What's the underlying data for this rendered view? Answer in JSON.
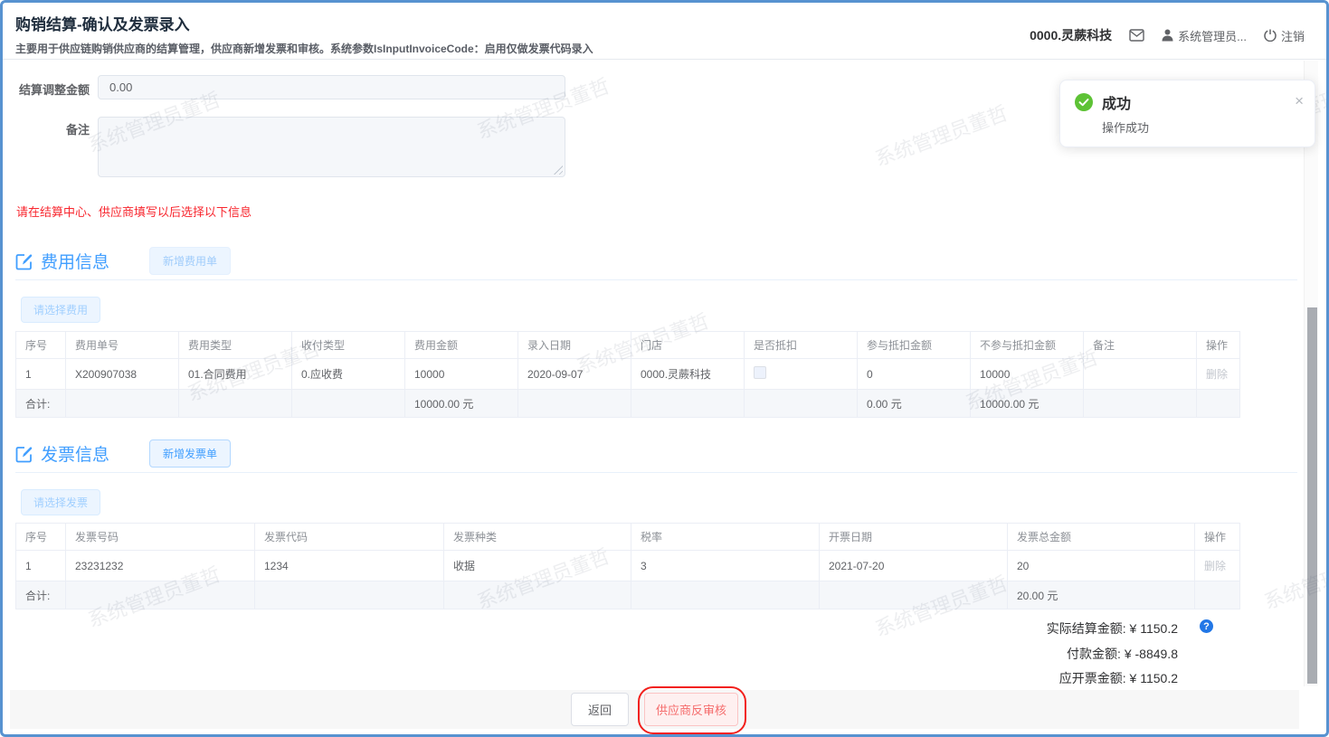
{
  "page": {
    "title": "购销结算-确认及发票录入",
    "subtitle": "主要用于供应链购销供应商的结算管理，供应商新增发票和审核。系统参数IsInputInvoiceCode：启用仅做发票代码录入"
  },
  "topbar": {
    "company": "0000.灵蕨科技",
    "user": "系统管理员...",
    "logout": "注销"
  },
  "toast": {
    "title": "成功",
    "message": "操作成功",
    "close": "×"
  },
  "form": {
    "adjust_label": "结算调整金额",
    "adjust_value": "0.00",
    "remark_label": "备注",
    "remark_value": ""
  },
  "warning": "请在结算中心、供应商填写以后选择以下信息",
  "fee_section": {
    "title": "费用信息",
    "add_button": "新增费用单",
    "select_button": "请选择费用",
    "table": {
      "headers": [
        "序号",
        "费用单号",
        "费用类型",
        "收付类型",
        "费用金额",
        "录入日期",
        "门店",
        "是否抵扣",
        "参与抵扣金额",
        "不参与抵扣金额",
        "备注",
        "操作"
      ],
      "rows": [
        [
          "1",
          "X200907038",
          "01.合同费用",
          "0.应收费",
          "10000",
          "2020-09-07",
          "0000.灵蕨科技",
          "",
          "0",
          "10000",
          "",
          "删除"
        ]
      ],
      "totals": [
        "合计:",
        "",
        "",
        "",
        "10000.00 元",
        "",
        "",
        "",
        "0.00 元",
        "10000.00 元",
        "",
        ""
      ]
    }
  },
  "invoice_section": {
    "title": "发票信息",
    "add_button": "新增发票单",
    "select_button": "请选择发票",
    "table": {
      "headers": [
        "序号",
        "发票号码",
        "发票代码",
        "发票种类",
        "税率",
        "开票日期",
        "发票总金额",
        "操作"
      ],
      "rows": [
        [
          "1",
          "23231232",
          "1234",
          "收据",
          "3",
          "2021-07-20",
          "20",
          "删除"
        ]
      ],
      "totals": [
        "合计:",
        "",
        "",
        "",
        "",
        "",
        "20.00 元",
        ""
      ]
    }
  },
  "summary": {
    "items": [
      {
        "label": "实际结算金额:",
        "value": "¥ 1150.2"
      },
      {
        "label": "付款金额:",
        "value": "¥ -8849.8"
      },
      {
        "label": "应开票金额:",
        "value": "¥ 1150.2"
      }
    ],
    "help_symbol": "?"
  },
  "footer": {
    "back": "返回",
    "reverse_audit": "供应商反审核"
  },
  "watermark": "系统管理员董哲",
  "colors": {
    "accent": "#409eff",
    "success": "#67c23a",
    "danger": "#f56c6c",
    "warning_red": "#f8262e",
    "frame_blue": "#5792d0"
  }
}
